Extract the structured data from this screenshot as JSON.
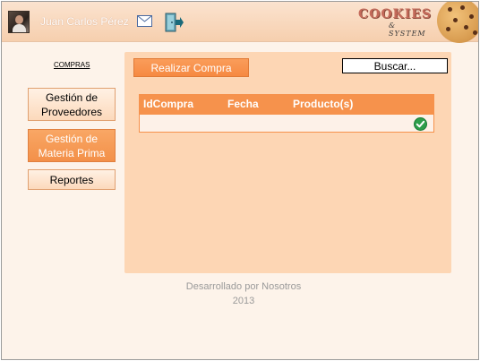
{
  "header": {
    "user_name": "Juan Carlos Pérez",
    "logo_text": "COOKIES",
    "logo_subtext": "& SYSTEM",
    "icons": [
      "avatar",
      "mail-icon",
      "exit-icon",
      "cookie-icon"
    ]
  },
  "sidebar": {
    "section_label": "COMPRAS",
    "items": [
      {
        "label": "Gestión de Proveedores",
        "state": "normal"
      },
      {
        "label": "Gestión de Materia Prima",
        "state": "active"
      },
      {
        "label": "Reportes",
        "state": "normal"
      }
    ]
  },
  "main": {
    "action_button": "Realizar Compra",
    "search_label": "Buscar...",
    "table": {
      "columns": [
        "IdCompra",
        "Fecha",
        "Producto(s)"
      ],
      "rows": [
        {
          "idcompra": "",
          "fecha": "",
          "productos": "",
          "status_icon": "check-icon"
        }
      ]
    }
  },
  "footer": {
    "line1": "Desarrollado por Nosotros",
    "line2": "2013"
  },
  "colors": {
    "accent": "#f6924c",
    "panel": "#fdd6b4",
    "header": "#f6cfae",
    "background": "#fdf3ea"
  }
}
